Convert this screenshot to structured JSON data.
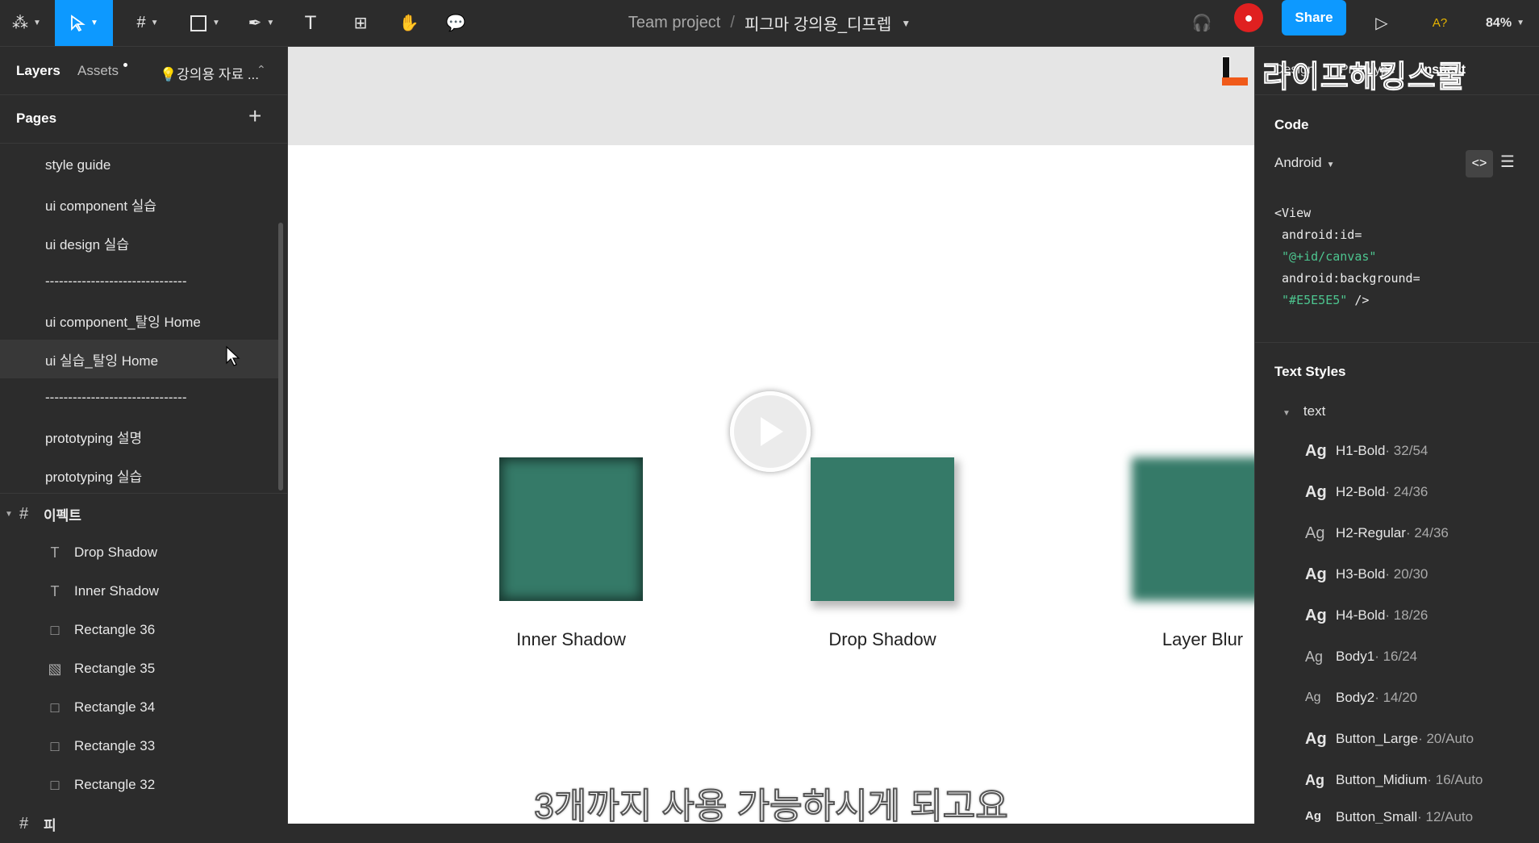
{
  "toolbar": {
    "tools": [
      {
        "name": "figma-menu",
        "icon": "figma-logo-icon"
      },
      {
        "name": "move",
        "icon": "cursor-arrow-icon"
      },
      {
        "name": "frame",
        "icon": "hash-frame-icon"
      },
      {
        "name": "shape",
        "icon": "rectangle-icon"
      },
      {
        "name": "pen",
        "icon": "pen-icon"
      },
      {
        "name": "text",
        "icon": "text-T-icon"
      },
      {
        "name": "resources",
        "icon": "components-icon"
      },
      {
        "name": "hand",
        "icon": "hand-icon"
      },
      {
        "name": "comment",
        "icon": "speech-bubble-icon"
      }
    ],
    "team": "Team project",
    "separator": "/",
    "file_name": "피그마 강의용_디프렙",
    "share_label": "Share",
    "font_warning": "A?",
    "zoom": "84%"
  },
  "left": {
    "tabs": {
      "layers": "Layers",
      "assets": "Assets",
      "library": "💡강의용 자료 ..."
    },
    "pages_title": "Pages",
    "pages": [
      "style guide",
      "ui component 실습",
      "ui design 실습",
      "-------------------------------",
      "ui component_탈잉 Home",
      "ui 실습_탈잉 Home",
      "-------------------------------",
      "prototyping 설명",
      "prototyping 실습"
    ],
    "frame_name": "이펙트",
    "layers": [
      {
        "label": "Drop Shadow",
        "icon": "T"
      },
      {
        "label": "Inner Shadow",
        "icon": "T"
      },
      {
        "label": "Rectangle 36",
        "icon": "□"
      },
      {
        "label": "Rectangle 35",
        "icon": "▧"
      },
      {
        "label": "Rectangle 34",
        "icon": "□"
      },
      {
        "label": "Rectangle 33",
        "icon": "□"
      },
      {
        "label": "Rectangle 32",
        "icon": "□"
      }
    ],
    "next_frame": "피"
  },
  "canvas": {
    "captions": {
      "inner": "Inner Shadow",
      "drop": "Drop Shadow",
      "blur": "Layer Blur"
    },
    "subtitle": "3개까지 사용 가능하시게 되고요",
    "square_color": "#357a68"
  },
  "right": {
    "tabs": {
      "design": "Design",
      "prototype": "Prototype",
      "inspect": "Inspect"
    },
    "watermark": "라이프해킹스쿨",
    "code_title": "Code",
    "platform": "Android",
    "code": {
      "line1": "<View",
      "line2": " android:id=",
      "line3": " \"@+id/canvas\"",
      "line4": " android:background=",
      "line5": " \"#E5E5E5\"",
      "line5b": " />"
    },
    "text_styles_title": "Text Styles",
    "group": "text",
    "styles": [
      {
        "name": "H1-Bold",
        "meta": " · 32/54",
        "bold": true
      },
      {
        "name": "H2-Bold",
        "meta": " · 24/36",
        "bold": true
      },
      {
        "name": "H2-Regular",
        "meta": " · 24/36",
        "bold": false
      },
      {
        "name": "H3-Bold",
        "meta": " · 20/30",
        "bold": true
      },
      {
        "name": "H4-Bold",
        "meta": " · 18/26",
        "bold": true
      },
      {
        "name": "Body1",
        "meta": " · 16/24",
        "bold": false
      },
      {
        "name": "Body2",
        "meta": " · 14/20",
        "bold": false
      },
      {
        "name": "Button_Large",
        "meta": " · 20/Auto",
        "bold": true
      },
      {
        "name": "Button_Midium",
        "meta": " · 16/Auto",
        "bold": true
      },
      {
        "name": "Button_Small",
        "meta": " · 12/Auto",
        "bold": true
      }
    ]
  }
}
